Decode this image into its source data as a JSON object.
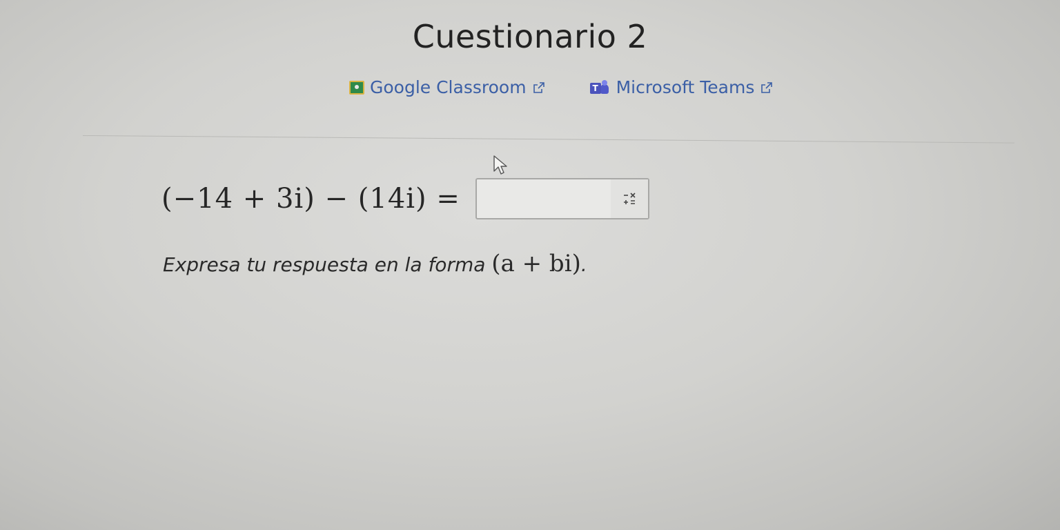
{
  "page": {
    "title": "Cuestionario 2"
  },
  "share": {
    "classroom_label": "Google Classroom",
    "teams_label": "Microsoft Teams"
  },
  "question": {
    "equation": "(−14 + 3i) − (14i) =",
    "answer_value": "",
    "instruction_text": "Expresa tu respuesta en la forma",
    "instruction_math": "(a + bi)",
    "instruction_end": "."
  },
  "icons": {
    "classroom": "google-classroom-icon",
    "teams": "microsoft-teams-icon",
    "external": "external-link-icon",
    "palette": "math-palette-icon",
    "cursor": "mouse-cursor-icon"
  },
  "colors": {
    "link": "#3b5fa6",
    "classroom_green": "#2f8a4a",
    "teams_purple": "#4b53bc"
  }
}
